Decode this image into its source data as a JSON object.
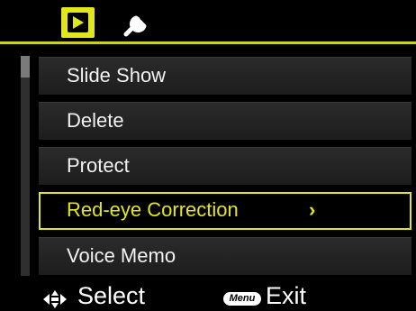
{
  "tabs": [
    {
      "icon": "playback-icon",
      "active": true
    },
    {
      "icon": "wrench-icon",
      "active": false
    }
  ],
  "menu": {
    "items": [
      {
        "label": "Slide Show"
      },
      {
        "label": "Delete"
      },
      {
        "label": "Protect"
      },
      {
        "label": "Red-eye Correction",
        "selected": true,
        "submenu_indicator": "›"
      },
      {
        "label": "Voice Memo"
      }
    ]
  },
  "footer": {
    "select_label": "Select",
    "menu_key_label": "Menu",
    "exit_label": "Exit"
  },
  "colors": {
    "accent": "#e3e61d",
    "background": "#000000",
    "item_bg": "#252525"
  }
}
